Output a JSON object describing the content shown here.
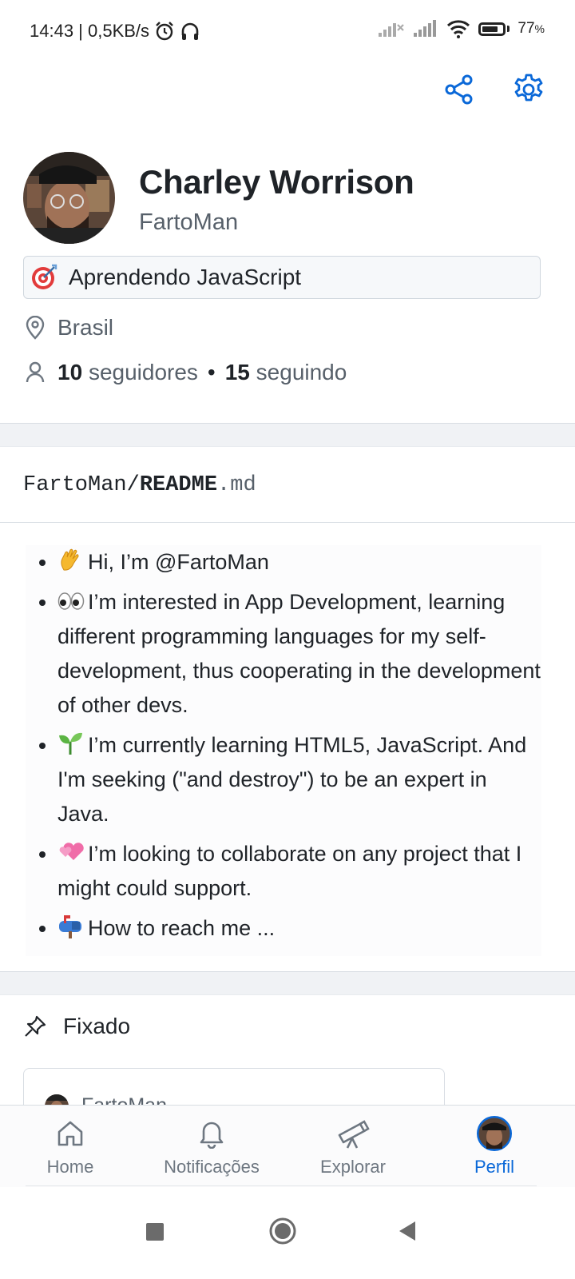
{
  "status_bar": {
    "time_speed": "14:43 | 0,5KB/s",
    "battery_percent": "77",
    "battery_unit": "%",
    "battery_level": 0.77
  },
  "header": {
    "share_icon": "share-icon",
    "settings_icon": "gear-icon"
  },
  "profile": {
    "name": "Charley Worrison",
    "login": "FartoMan",
    "status": "Aprendendo JavaScript",
    "status_emoji": "dart-emoji",
    "location": "Brasil",
    "followers_count": "10",
    "followers_label": "seguidores",
    "separator": "•",
    "following_count": "15",
    "following_label": "seguindo"
  },
  "readme": {
    "owner": "FartoMan/",
    "name": "README",
    "ext": ".md",
    "items": [
      {
        "emoji": "waving-hand",
        "text": "Hi, I’m @FartoMan"
      },
      {
        "emoji": "eyes",
        "text": "I’m interested in App Development, learning different programming languages for my self-development, thus cooperating in the development of other devs."
      },
      {
        "emoji": "seedling",
        "text": "I’m currently learning HTML5, JavaScript. And I'm seeking (\"and destroy\") to be an expert in Java."
      },
      {
        "emoji": "two-hearts",
        "text": "I’m looking to collaborate on any project that I might could support."
      },
      {
        "emoji": "mailbox",
        "text": "How to reach me ..."
      }
    ]
  },
  "pinned": {
    "label": "Fixado",
    "card_owner": "FartoMan"
  },
  "bottom_nav": {
    "items": [
      {
        "label": "Home",
        "icon": "home-icon"
      },
      {
        "label": "Notificações",
        "icon": "bell-icon"
      },
      {
        "label": "Explorar",
        "icon": "telescope-icon"
      },
      {
        "label": "Perfil",
        "icon": "avatar"
      }
    ],
    "active": "Perfil",
    "active_color": "#0a68d8"
  },
  "system_nav": {
    "buttons": [
      "recents-button",
      "home-button",
      "back-button"
    ]
  }
}
